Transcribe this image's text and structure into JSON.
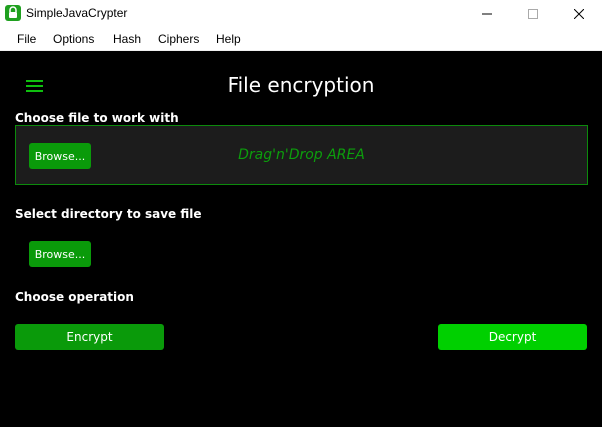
{
  "window": {
    "title": "SimpleJavaCrypter",
    "icon": "lock-icon",
    "controls": [
      "minimize-icon",
      "maximize-icon",
      "close-icon"
    ]
  },
  "menu": {
    "items": [
      "File",
      "Options",
      "Hash",
      "Ciphers",
      "Help"
    ]
  },
  "main": {
    "heading": "File encryption",
    "menu_icon": "hamburger-icon",
    "choose_file_label": "Choose file to work with",
    "browse_file_label": "Browse...",
    "dropzone_text": "Drag'n'Drop AREA",
    "select_dir_label": "Select directory to save file",
    "browse_dir_label": "Browse...",
    "choose_operation_label": "Choose operation",
    "encrypt_label": "Encrypt",
    "decrypt_label": "Decrypt"
  },
  "colors": {
    "accent_dark": "#0a9a0a",
    "accent_bright": "#00d000",
    "background": "#000000",
    "dropzone_bg": "#1c1c1c"
  }
}
